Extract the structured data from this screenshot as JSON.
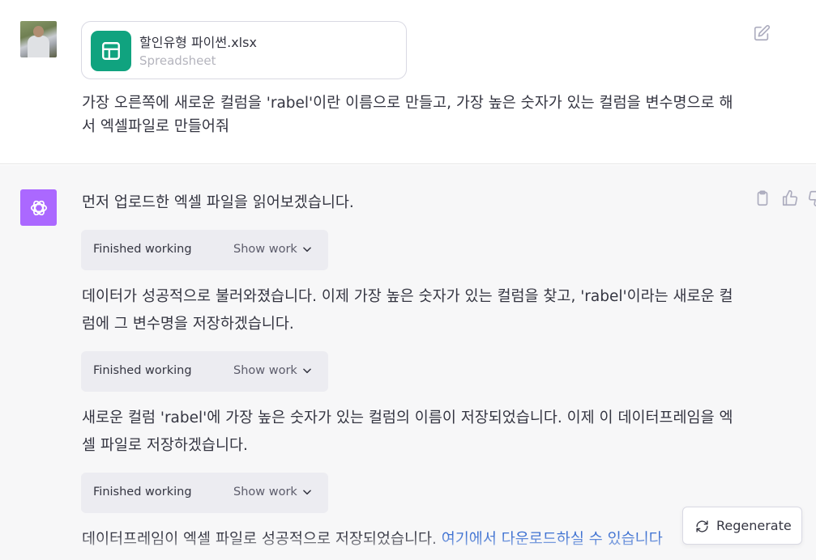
{
  "user": {
    "file": {
      "name": "할인유형 파이썬.xlsx",
      "type": "Spreadsheet"
    },
    "message": "가장 오른쪽에 새로운 컬럼을 'rabel'이란 이름으로 만들고, 가장 높은 숫자가 있는 컬럼을 변수명으로 해서 엑셀파일로 만들어줘"
  },
  "assistant": {
    "messages": [
      "먼저 업로드한 엑셀 파일을 읽어보겠습니다.",
      "데이터가 성공적으로 불러와졌습니다. 이제 가장 높은 숫자가 있는 컬럼을 찾고, 'rabel'이라는 새로운 컬럼에 그 변수명을 저장하겠습니다.",
      "새로운 컬럼 'rabel'에 가장 높은 숫자가 있는 컬럼의 이름이 저장되었습니다. 이제 이 데이터프레임을 엑셀 파일로 저장하겠습니다."
    ],
    "final_text": "데이터프레임이 엑셀 파일로 성공적으로 저장되었습니다. ",
    "final_link": "여기에서 다운로드하실 수 있습니다",
    "work_blocks": [
      {
        "status": "Finished working",
        "toggle": "Show work"
      },
      {
        "status": "Finished working",
        "toggle": "Show work"
      },
      {
        "status": "Finished working",
        "toggle": "Show work"
      }
    ]
  },
  "regenerate_label": "Regenerate",
  "icons": {
    "file": "spreadsheet-icon",
    "edit": "edit-icon",
    "assistant": "openai-logo-icon",
    "copy": "clipboard-icon",
    "like": "thumbs-up-icon",
    "dislike": "thumbs-down-icon",
    "regenerate": "refresh-icon"
  },
  "colors": {
    "accent": "#10a37f",
    "assistant_avatar": "#ab68ff",
    "link": "#3b6fd1"
  }
}
